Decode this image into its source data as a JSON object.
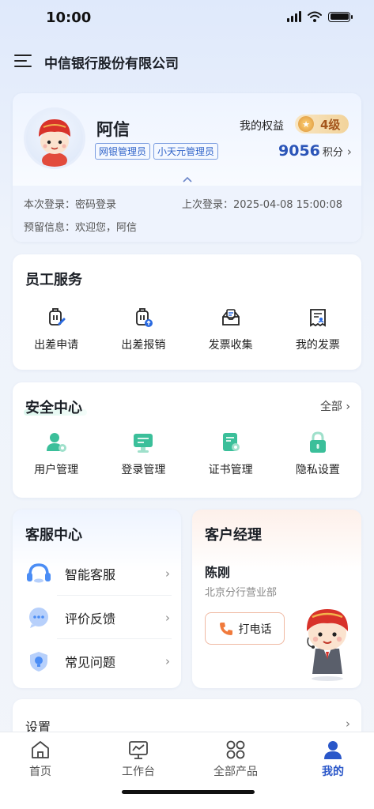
{
  "status_bar": {
    "time": "10:00"
  },
  "header": {
    "title": "中信银行股份有限公司"
  },
  "profile": {
    "name": "阿信",
    "roles": [
      "网银管理员",
      "小天元管理员"
    ],
    "benefit_label": "我的权益",
    "level": "4级",
    "points": "9056",
    "points_unit": "积分",
    "login_method": "本次登录：密码登录",
    "last_login": "上次登录：2025-04-08 15:00:08",
    "reserved_info": "预留信息：欢迎您，阿信"
  },
  "employee_services": {
    "title": "员工服务",
    "items": [
      {
        "label": "出差申请",
        "icon": "travel-apply-icon"
      },
      {
        "label": "出差报销",
        "icon": "travel-reimburse-icon"
      },
      {
        "label": "发票收集",
        "icon": "invoice-collect-icon"
      },
      {
        "label": "我的发票",
        "icon": "my-invoice-icon"
      }
    ]
  },
  "security_center": {
    "title": "安全中心",
    "more_label": "全部",
    "items": [
      {
        "label": "用户管理",
        "icon": "user-manage-icon"
      },
      {
        "label": "登录管理",
        "icon": "login-manage-icon"
      },
      {
        "label": "证书管理",
        "icon": "certificate-icon"
      },
      {
        "label": "隐私设置",
        "icon": "lock-icon"
      }
    ]
  },
  "customer_service": {
    "title": "客服中心",
    "items": [
      {
        "label": "智能客服",
        "icon": "headset-icon"
      },
      {
        "label": "评价反馈",
        "icon": "chat-bubble-icon"
      },
      {
        "label": "常见问题",
        "icon": "faq-bulb-icon"
      }
    ]
  },
  "account_manager": {
    "title": "客户经理",
    "name": "陈刚",
    "department": "北京分行营业部",
    "call_label": "打电话"
  },
  "settings": {
    "label": "设置"
  },
  "tabbar": {
    "tabs": [
      {
        "label": "首页",
        "icon": "home-icon"
      },
      {
        "label": "工作台",
        "icon": "workbench-icon"
      },
      {
        "label": "全部产品",
        "icon": "products-grid-icon"
      },
      {
        "label": "我的",
        "icon": "profile-icon",
        "active": true
      }
    ]
  },
  "colors": {
    "accent": "#2a57c9",
    "section_green": "#3bbf9a",
    "text": "#1f2329"
  }
}
